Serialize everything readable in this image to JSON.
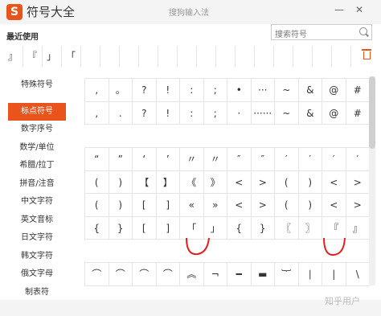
{
  "app": {
    "logo": "S",
    "title": "符号大全",
    "subtitle": "搜狗输入法"
  },
  "window": {
    "minimize": "—",
    "close": "✕"
  },
  "recent": {
    "label": "最近使用",
    "items": [
      "』",
      "『",
      "」",
      "「"
    ]
  },
  "search": {
    "placeholder": "搜索符号"
  },
  "sidebar": {
    "items": [
      {
        "label": "特殊符号"
      },
      {
        "label": "标点符号"
      },
      {
        "label": "数字序号"
      },
      {
        "label": "数学/单位"
      },
      {
        "label": "希腊/拉丁"
      },
      {
        "label": "拼音/注音"
      },
      {
        "label": "中文字符"
      },
      {
        "label": "英文音标"
      },
      {
        "label": "日文字符"
      },
      {
        "label": "韩文字符"
      },
      {
        "label": "俄文字母"
      },
      {
        "label": "制表符"
      }
    ],
    "active": 1
  },
  "sections": [
    {
      "rows": [
        [
          ",",
          "。",
          "?",
          "!",
          ":",
          ";",
          "•",
          "···",
          "~",
          "&",
          "@",
          "#"
        ],
        [
          ",",
          ".",
          "?",
          "!",
          ":",
          ";",
          "·",
          "······",
          "~",
          "&",
          "@",
          "#"
        ]
      ]
    },
    {
      "rows": [
        [
          "“",
          "”",
          "‘",
          "’",
          "〃",
          "〃",
          "″",
          "″",
          "′",
          "′",
          "′",
          "′"
        ],
        [
          "(",
          ")",
          "【",
          "】",
          "《",
          "》",
          "<",
          ">",
          "(",
          ")",
          "<",
          ">"
        ],
        [
          "(",
          ")",
          "[",
          "]",
          "«",
          "»",
          "<",
          ">",
          "(",
          ")",
          "<",
          ">"
        ],
        [
          "{",
          "}",
          "[",
          "]",
          "「",
          "」",
          "{",
          "}",
          "〖",
          "〗",
          "『",
          "』"
        ]
      ]
    },
    {
      "rows": [
        [
          "⌒",
          "⌒",
          "⌒",
          "⌒",
          "︽",
          "¬",
          "━",
          "▬",
          "︸",
          "∣",
          "|",
          "\\"
        ]
      ]
    }
  ],
  "annotation_color": "#e02020",
  "watermark": "知乎用户"
}
